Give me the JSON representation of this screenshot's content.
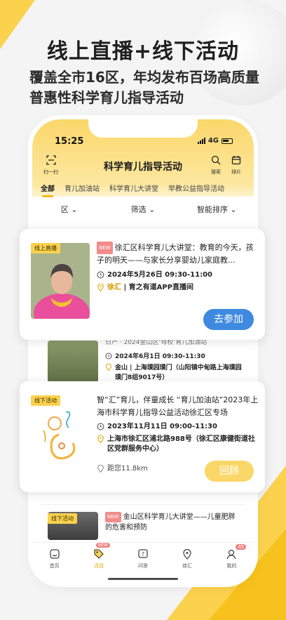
{
  "hero": {
    "title": "线上直播+线下活动",
    "subtitle": "覆盖全市16区，年均发布百场高质量普惠性科学育儿指导活动"
  },
  "status_bar": {
    "time": "15:25",
    "network": "4G"
  },
  "nav": {
    "scan_label": "扫一扫",
    "title": "科学育儿指导活动",
    "search_label": "搜索",
    "schedule_label": "排片"
  },
  "tabs": [
    "全部",
    "育儿加油站",
    "科学育儿大讲堂",
    "早教公益指导活动"
  ],
  "filters": {
    "district": "区",
    "filter": "筛选",
    "sort": "智能排序"
  },
  "cards": [
    {
      "badge": "线上直播",
      "new_tag": "NEW",
      "title": "徐汇区科学育儿大讲堂：教育的今天，孩子的明天——与家长分享婴幼儿家庭教...",
      "datetime": "2024年5月26日 09:30-11:00",
      "location_area": "徐汇",
      "location_detail": "育之有道APP直播间",
      "action": "去参加"
    },
    {
      "title_partial": "日产 · 2024金山区‘母校’育儿加油站",
      "datetime": "2024年6月1日 09:30-11:30",
      "location_area": "金山",
      "location_detail": "上海璞园璞门（山阳镇中甸路上海璞园璞门8组9017号）"
    },
    {
      "badge": "线下活动",
      "title": "智“汇”育儿，伴童成长 “育儿加油站”2023年上海市科学育儿指导公益活动徐汇区专场",
      "datetime": "2023年11月11日 09:00-11:30",
      "location_detail": "上海市徐汇区浦北路988号（徐汇区康健街道社区党群服务中心）",
      "distance": "距您11.8km",
      "action": "回顾"
    },
    {
      "badge": "线下活动",
      "new_tag": "NEW",
      "title": "金山区科学育儿大讲堂——儿童肥胖的危害和预防"
    }
  ],
  "bottom_nav": {
    "items": [
      "首页",
      "活动",
      "问答",
      "徐汇",
      "我的"
    ],
    "active": "活动",
    "activity_badge": "NEW",
    "mine_count": "45"
  },
  "colors": {
    "accent_yellow": "#fbd24e",
    "join_blue": "#3f8ae0",
    "review_yellow": "#fbd769",
    "location_orange": "#d49a00"
  }
}
